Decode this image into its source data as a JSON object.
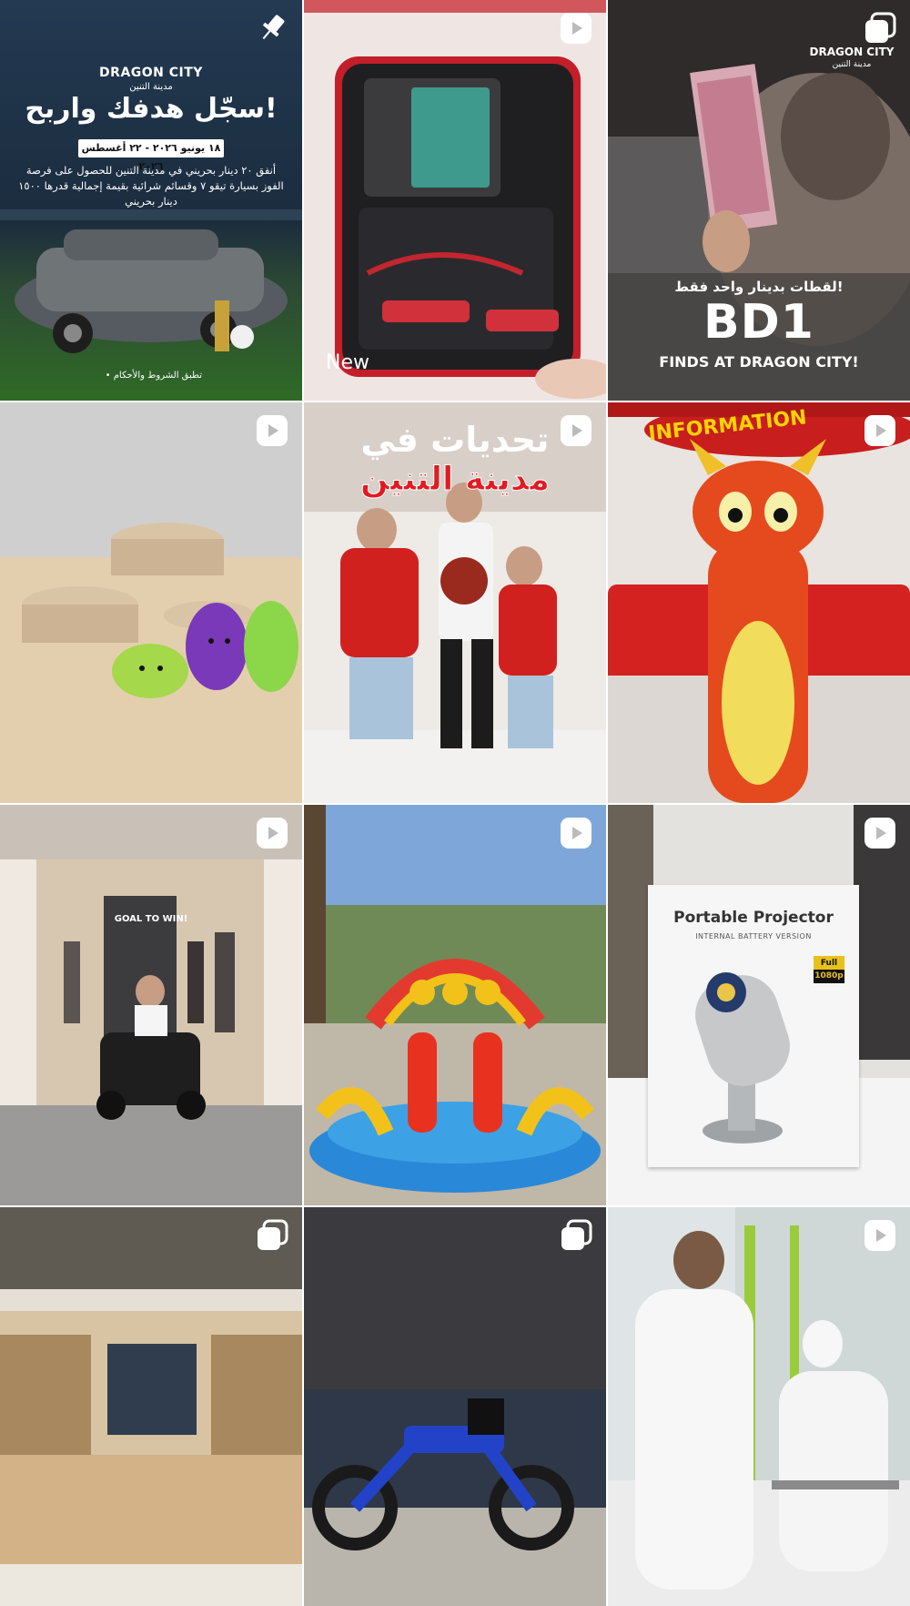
{
  "grid": {
    "posts": [
      {
        "index": 1,
        "badge": "pin-icon",
        "brand": "DRAGON CITY",
        "brand_ar": "مدينة التنين",
        "headline": "سجّل هدفك واربح!",
        "date_range": "١٨ يونيو ٢٠٢٦ - ٢٢ أغسطس ٢٠٢٦",
        "description": "أنفق ٢٠ دينار بحريني في مدينة التنين للحصول على فرصة الفوز بسيارة تيقو ٧ وقسائم شرائية بقيمة إجمالية قدرها ١٥٠٠ دينار بحريني",
        "terms": "• تطبق الشروط والأحكام"
      },
      {
        "index": 2,
        "badge": "reel-icon",
        "caption": "New"
      },
      {
        "index": 3,
        "badge": "carousel-icon",
        "brand": "DRAGON CITY",
        "brand_ar": "مدينة التنين",
        "headline_ar": "لقطات بدينار واحد فقط!",
        "headline_big": "BD1",
        "headline_sub": "FINDS AT DRAGON CITY!"
      },
      {
        "index": 4,
        "badge": "reel-icon"
      },
      {
        "index": 5,
        "badge": "reel-icon",
        "title_line1": "تحديات في",
        "title_line2": "مدينة التنين"
      },
      {
        "index": 6,
        "badge": "reel-icon",
        "sign": "INFORMATION"
      },
      {
        "index": 7,
        "badge": "reel-icon",
        "sign": "GOAL TO WIN!"
      },
      {
        "index": 8,
        "badge": "reel-icon"
      },
      {
        "index": 9,
        "badge": "reel-icon",
        "product_title": "Portable Projector",
        "product_subtitle": "INTERNAL BATTERY VERSION",
        "hd_label": "Full HD",
        "hd_res": "1080p"
      },
      {
        "index": 10,
        "badge": "carousel-icon"
      },
      {
        "index": 11,
        "badge": "carousel-icon"
      },
      {
        "index": 12,
        "badge": "reel-icon"
      }
    ]
  },
  "colors": {
    "grid_gap": "#ffffff",
    "badge": "#ffffff",
    "accent_red": "#e11b22"
  }
}
